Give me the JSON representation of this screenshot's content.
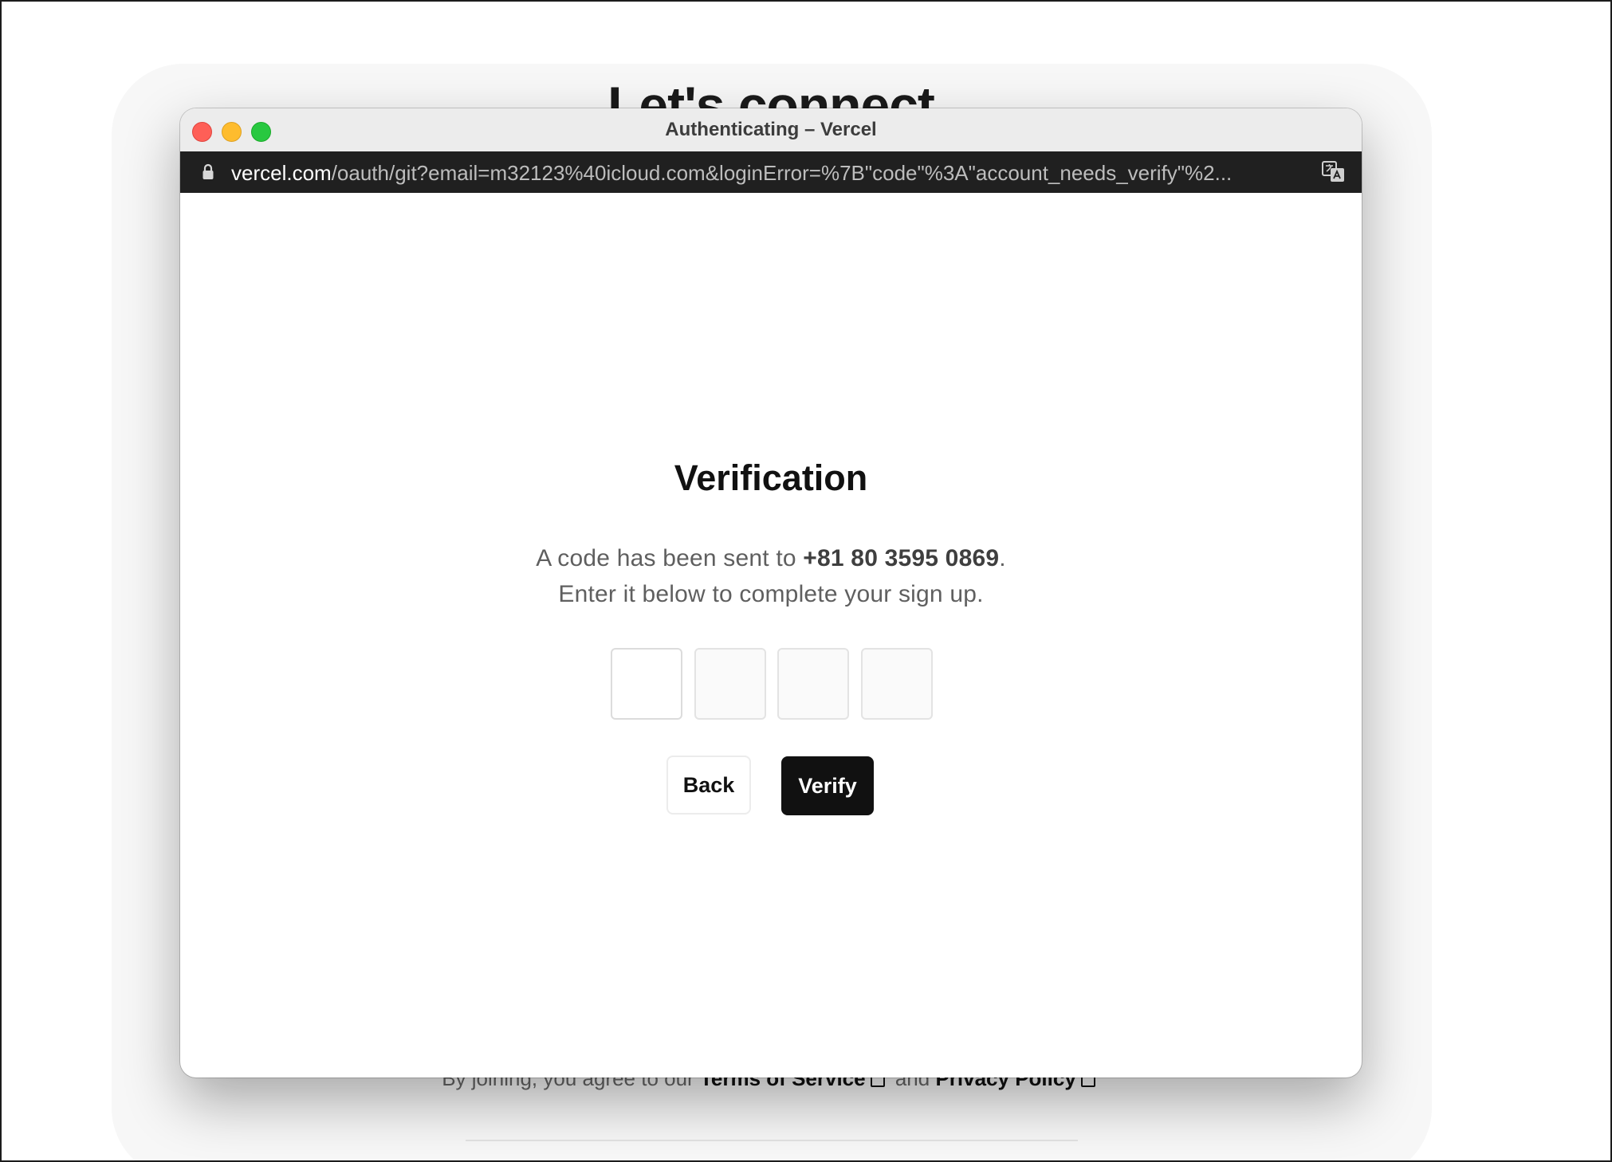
{
  "background": {
    "heading": "Let's connect",
    "footer": {
      "prefix": "By joining, you agree to our",
      "terms_link": "Terms of Service",
      "conjunction": "and",
      "privacy_link": "Privacy Policy"
    }
  },
  "window": {
    "title": "Authenticating – Vercel"
  },
  "urlbar": {
    "domain": "vercel.com",
    "path": "/oauth/git?email=m32123%40icloud.com&loginError=%7B\"code\"%3A\"account_needs_verify\"%2..."
  },
  "verification": {
    "title": "Verification",
    "line1_prefix": "A code has been sent to",
    "phone": "+81 80 3595 0869",
    "line1_suffix": ".",
    "line2": "Enter it below to complete your sign up.",
    "code_digits": [
      "",
      "",
      "",
      ""
    ],
    "back_label": "Back",
    "verify_label": "Verify"
  },
  "colors": {
    "verify_button_bg": "#111111",
    "urlbar_bg": "#202020",
    "traffic_red": "#fe5f57",
    "traffic_yellow": "#febc2e",
    "traffic_green": "#28c840"
  },
  "icons": {
    "lock": "lock-icon",
    "translate": "translate-icon",
    "external_link": "external-link-icon"
  }
}
